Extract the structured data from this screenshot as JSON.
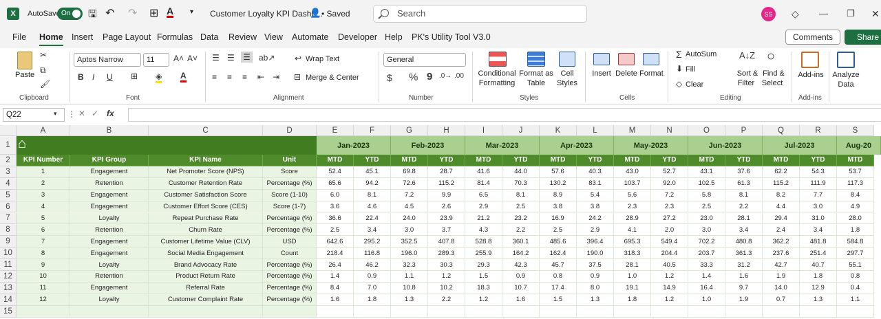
{
  "title_bar": {
    "autosave": "AutoSave",
    "toggle": "On",
    "doc_title": "Customer Loyalty KPI Dashb...",
    "saved": "• Saved",
    "search": "Search",
    "avatar": "SS"
  },
  "menu": [
    "File",
    "Home",
    "Insert",
    "Page Layout",
    "Formulas",
    "Data",
    "Review",
    "View",
    "Automate",
    "Developer",
    "Help",
    "PK's Utility Tool V3.0"
  ],
  "menu_right": {
    "comments": "Comments",
    "share": "Share"
  },
  "ribbon": {
    "clipboard": {
      "paste": "Paste",
      "label": "Clipboard"
    },
    "font": {
      "name": "Aptos Narrow",
      "size": "11",
      "label": "Font",
      "bold": "B",
      "italic": "I",
      "underline": "U"
    },
    "alignment": {
      "wrap": "Wrap Text",
      "merge": "Merge & Center",
      "label": "Alignment"
    },
    "number": {
      "format": "General",
      "dollar": "$",
      "percent": "%",
      "comma": "9",
      "label": "Number"
    },
    "styles": {
      "cond1": "Conditional",
      "cond2": "Formatting",
      "fmt1": "Format as",
      "fmt2": "Table",
      "cell1": "Cell",
      "cell2": "Styles",
      "label": "Styles"
    },
    "cells": {
      "insert": "Insert",
      "delete": "Delete",
      "format": "Format",
      "label": "Cells"
    },
    "editing": {
      "autosum": "AutoSum",
      "fill": "Fill",
      "clear": "Clear",
      "sort1": "Sort &",
      "sort2": "Filter",
      "find1": "Find &",
      "find2": "Select",
      "label": "Editing"
    },
    "addins": {
      "addins": "Add-ins",
      "label": "Add-ins"
    },
    "analyze": {
      "l1": "Analyze",
      "l2": "Data"
    }
  },
  "formula_bar": {
    "name_box": "Q22",
    "fx": "fx"
  },
  "grid": {
    "col_letters": [
      "A",
      "B",
      "C",
      "D",
      "E",
      "F",
      "G",
      "H",
      "I",
      "J",
      "K",
      "L",
      "M",
      "N",
      "O",
      "P",
      "Q",
      "R",
      "S"
    ],
    "row_numbers": [
      "1",
      "2",
      "3",
      "4",
      "5",
      "6",
      "7",
      "8",
      "9",
      "10",
      "11",
      "12",
      "13",
      "14",
      "15"
    ],
    "headers": [
      "KPI Number",
      "KPI Group",
      "KPI Name",
      "Unit"
    ],
    "months": [
      "Jan-2023",
      "Feb-2023",
      "Mar-2023",
      "Apr-2023",
      "May-2023",
      "Jun-2023",
      "Jul-2023",
      "Aug-20"
    ],
    "mtd": "MTD",
    "ytd": "YTD",
    "rows": [
      {
        "num": "1",
        "group": "Engagement",
        "name": "Net Promoter Score (NPS)",
        "unit": "Score",
        "vals": [
          "52.4",
          "45.1",
          "69.8",
          "28.7",
          "41.6",
          "44.0",
          "57.6",
          "40.3",
          "43.0",
          "52.7",
          "43.1",
          "37.6",
          "62.2",
          "54.3",
          "53.7"
        ]
      },
      {
        "num": "2",
        "group": "Retention",
        "name": "Customer Retention Rate",
        "unit": "Percentage (%)",
        "vals": [
          "65.6",
          "94.2",
          "72.6",
          "115.2",
          "81.4",
          "70.3",
          "130.2",
          "83.1",
          "103.7",
          "92.0",
          "102.5",
          "61.3",
          "115.2",
          "111.9",
          "117.3"
        ]
      },
      {
        "num": "3",
        "group": "Engagement",
        "name": "Customer Satisfaction Score",
        "unit": "Score (1-10)",
        "vals": [
          "6.0",
          "8.1",
          "7.2",
          "9.9",
          "6.5",
          "8.1",
          "8.9",
          "5.4",
          "5.6",
          "7.2",
          "5.8",
          "8.1",
          "8.2",
          "7.7",
          "8.4"
        ]
      },
      {
        "num": "4",
        "group": "Engagement",
        "name": "Customer Effort Score (CES)",
        "unit": "Score (1-7)",
        "vals": [
          "3.6",
          "4.6",
          "4.5",
          "2.6",
          "2.9",
          "2.5",
          "3.8",
          "3.8",
          "2.3",
          "2.3",
          "2.5",
          "2.2",
          "4.4",
          "3.0",
          "4.9"
        ]
      },
      {
        "num": "5",
        "group": "Loyalty",
        "name": "Repeat Purchase Rate",
        "unit": "Percentage (%)",
        "vals": [
          "36.6",
          "22.4",
          "24.0",
          "23.9",
          "21.2",
          "23.2",
          "16.9",
          "24.2",
          "28.9",
          "27.2",
          "23.0",
          "28.1",
          "29.4",
          "31.0",
          "28.0"
        ]
      },
      {
        "num": "6",
        "group": "Retention",
        "name": "Churn Rate",
        "unit": "Percentage (%)",
        "vals": [
          "2.5",
          "3.4",
          "3.0",
          "3.7",
          "4.3",
          "2.2",
          "2.5",
          "2.9",
          "4.1",
          "2.0",
          "3.0",
          "3.4",
          "2.4",
          "3.4",
          "1.8"
        ]
      },
      {
        "num": "7",
        "group": "Engagement",
        "name": "Customer Lifetime Value (CLV)",
        "unit": "USD",
        "vals": [
          "642.6",
          "295.2",
          "352.5",
          "407.8",
          "528.8",
          "360.1",
          "485.6",
          "396.4",
          "695.3",
          "549.4",
          "702.2",
          "480.8",
          "362.2",
          "481.8",
          "584.8"
        ]
      },
      {
        "num": "8",
        "group": "Engagement",
        "name": "Social Media Engagement",
        "unit": "Count",
        "vals": [
          "218.4",
          "116.8",
          "196.0",
          "289.3",
          "255.9",
          "164.2",
          "162.4",
          "190.0",
          "318.3",
          "204.4",
          "203.7",
          "361.3",
          "237.6",
          "251.4",
          "297.7"
        ]
      },
      {
        "num": "9",
        "group": "Loyalty",
        "name": "Brand Advocacy Rate",
        "unit": "Percentage (%)",
        "vals": [
          "26.4",
          "46.2",
          "32.3",
          "30.3",
          "29.3",
          "42.3",
          "45.7",
          "37.5",
          "28.1",
          "40.5",
          "33.3",
          "31.2",
          "42.7",
          "40.7",
          "55.1"
        ]
      },
      {
        "num": "10",
        "group": "Retention",
        "name": "Product Return Rate",
        "unit": "Percentage (%)",
        "vals": [
          "1.4",
          "0.9",
          "1.1",
          "1.2",
          "1.5",
          "0.9",
          "0.8",
          "0.9",
          "1.0",
          "1.2",
          "1.4",
          "1.6",
          "1.9",
          "1.8",
          "0.8"
        ]
      },
      {
        "num": "11",
        "group": "Engagement",
        "name": "Referral Rate",
        "unit": "Percentage (%)",
        "vals": [
          "8.4",
          "7.0",
          "10.8",
          "10.2",
          "18.3",
          "10.7",
          "17.4",
          "8.0",
          "19.1",
          "14.9",
          "16.4",
          "9.7",
          "14.0",
          "12.9",
          "0.4"
        ]
      },
      {
        "num": "12",
        "group": "Loyalty",
        "name": "Customer Complaint Rate",
        "unit": "Percentage (%)",
        "vals": [
          "1.6",
          "1.8",
          "1.3",
          "2.2",
          "1.2",
          "1.6",
          "1.5",
          "1.3",
          "1.8",
          "1.2",
          "1.0",
          "1.9",
          "0.7",
          "1.3",
          "1.1"
        ]
      }
    ]
  },
  "colors": {
    "accent": "#1d6f42",
    "header_dark": "#3f7d20",
    "header_mid": "#4f8a2b",
    "month_fill": "#a9d08e",
    "label_fill": "#eaf4e2"
  }
}
